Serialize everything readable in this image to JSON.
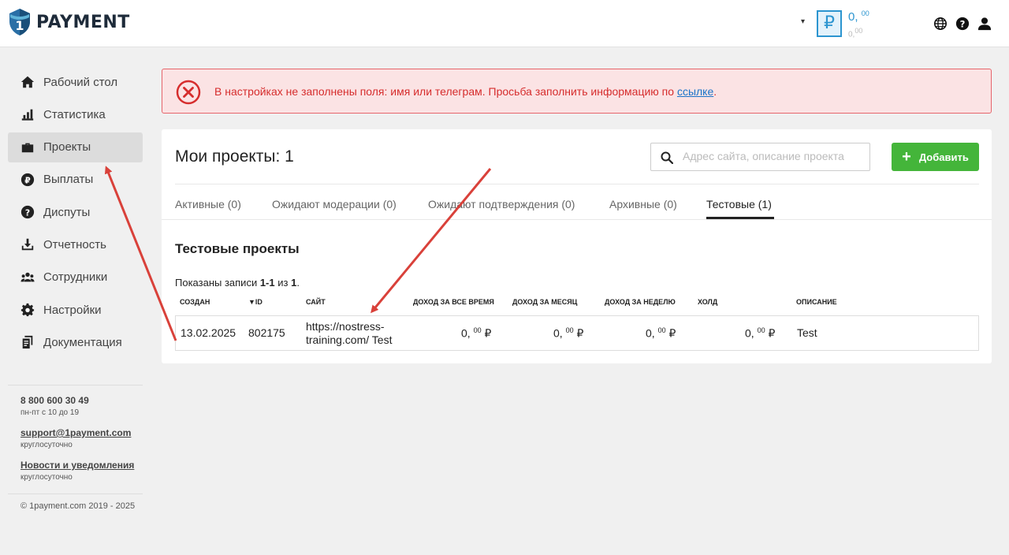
{
  "header": {
    "brand_digit": "1",
    "brand_name": "PAYMENT",
    "balance_dropdown": "▾",
    "currency_symbol": "₽",
    "balance_main": "0,",
    "balance_main_cents": "00",
    "balance_sub": "0,",
    "balance_sub_cents": "00"
  },
  "sidebar": {
    "items": [
      {
        "label": "Рабочий стол",
        "icon": "home-icon"
      },
      {
        "label": "Статистика",
        "icon": "stats-icon"
      },
      {
        "label": "Проекты",
        "icon": "briefcase-icon",
        "active": true
      },
      {
        "label": "Выплаты",
        "icon": "ruble-icon"
      },
      {
        "label": "Диспуты",
        "icon": "question-icon"
      },
      {
        "label": "Отчетность",
        "icon": "download-icon"
      },
      {
        "label": "Сотрудники",
        "icon": "people-icon"
      },
      {
        "label": "Настройки",
        "icon": "gear-icon"
      },
      {
        "label": "Документация",
        "icon": "documents-icon"
      }
    ],
    "phone": "8 800 600 30 49",
    "phone_hours": "пн-пт с 10 до 19",
    "email": "support@1payment.com",
    "email_hours": "круглосуточно",
    "news_link": "Новости и уведомления",
    "news_hours": "круглосуточно",
    "copyright": "© 1payment.com 2019 - 2025"
  },
  "alert": {
    "text": "В настройках не заполнены поля: имя или телеграм. Просьба заполнить информацию по ",
    "link": "ссылке",
    "end": ".",
    "color": "#d62d2d"
  },
  "main": {
    "title": "Мои проекты: 1",
    "search_placeholder": "Адрес сайта, описание проекта",
    "add_label": "Добавить",
    "tabs": [
      {
        "label": "Активные (0)"
      },
      {
        "label": "Ожидают модерации (0)"
      },
      {
        "label": "Ожидают подтверждения (0)"
      },
      {
        "label": "Архивные (0)"
      },
      {
        "label": "Тестовые (1)",
        "active": true
      }
    ],
    "section_title": "Тестовые проекты",
    "summary_prefix": "Показаны записи ",
    "summary_range": "1-1",
    "summary_mid": " из ",
    "summary_total": "1",
    "summary_end": ".",
    "columns": {
      "created": "Создан",
      "id": "▼ID",
      "site": "Сайт",
      "income_all": "Доход за все время",
      "income_month": "Доход за месяц",
      "income_week": "Доход за неделю",
      "hold": "Холд",
      "description": "Описание"
    },
    "rows": [
      {
        "created": "13.02.2025",
        "id": "802175",
        "site_line1": "https://nostress-",
        "site_line2": "training.com/ Test",
        "income_all": "0,",
        "income_all_cents": "00",
        "income_month": "0,",
        "income_month_cents": "00",
        "income_week": "0,",
        "income_week_cents": "00",
        "hold": "0,",
        "hold_cents": "00",
        "currency": "₽",
        "description": "Test"
      }
    ]
  },
  "colors": {
    "accent_blue": "#2c95d0",
    "add_green": "#44b53a",
    "alert_red": "#e6656b",
    "arrow_red": "#d9413a"
  }
}
